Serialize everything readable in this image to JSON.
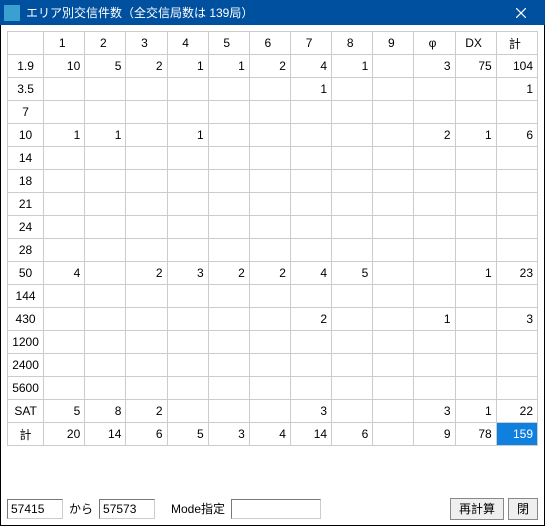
{
  "window": {
    "title": "エリア別交信件数（全交信局数は 139局）"
  },
  "grid": {
    "col_headers": [
      "1",
      "2",
      "3",
      "4",
      "5",
      "6",
      "7",
      "8",
      "9",
      "φ",
      "DX",
      "計"
    ],
    "row_headers": [
      "1.9",
      "3.5",
      "7",
      "10",
      "14",
      "18",
      "21",
      "24",
      "28",
      "50",
      "144",
      "430",
      "1200",
      "2400",
      "5600",
      "SAT",
      "計"
    ],
    "rows": [
      [
        "10",
        "5",
        "2",
        "1",
        "1",
        "2",
        "4",
        "1",
        "",
        "3",
        "75",
        "104"
      ],
      [
        "",
        "",
        "",
        "",
        "",
        "",
        "1",
        "",
        "",
        "",
        "",
        "1"
      ],
      [
        "",
        "",
        "",
        "",
        "",
        "",
        "",
        "",
        "",
        "",
        "",
        ""
      ],
      [
        "1",
        "1",
        "",
        "1",
        "",
        "",
        "",
        "",
        "",
        "2",
        "1",
        "6"
      ],
      [
        "",
        "",
        "",
        "",
        "",
        "",
        "",
        "",
        "",
        "",
        "",
        ""
      ],
      [
        "",
        "",
        "",
        "",
        "",
        "",
        "",
        "",
        "",
        "",
        "",
        ""
      ],
      [
        "",
        "",
        "",
        "",
        "",
        "",
        "",
        "",
        "",
        "",
        "",
        ""
      ],
      [
        "",
        "",
        "",
        "",
        "",
        "",
        "",
        "",
        "",
        "",
        "",
        ""
      ],
      [
        "",
        "",
        "",
        "",
        "",
        "",
        "",
        "",
        "",
        "",
        "",
        ""
      ],
      [
        "4",
        "",
        "2",
        "3",
        "2",
        "2",
        "4",
        "5",
        "",
        "",
        "1",
        "23"
      ],
      [
        "",
        "",
        "",
        "",
        "",
        "",
        "",
        "",
        "",
        "",
        "",
        ""
      ],
      [
        "",
        "",
        "",
        "",
        "",
        "",
        "2",
        "",
        "",
        "1",
        "",
        "3"
      ],
      [
        "",
        "",
        "",
        "",
        "",
        "",
        "",
        "",
        "",
        "",
        "",
        ""
      ],
      [
        "",
        "",
        "",
        "",
        "",
        "",
        "",
        "",
        "",
        "",
        "",
        ""
      ],
      [
        "",
        "",
        "",
        "",
        "",
        "",
        "",
        "",
        "",
        "",
        "",
        ""
      ],
      [
        "5",
        "8",
        "2",
        "",
        "",
        "",
        "3",
        "",
        "",
        "3",
        "1",
        "22"
      ],
      [
        "20",
        "14",
        "6",
        "5",
        "3",
        "4",
        "14",
        "6",
        "",
        "9",
        "78",
        "159"
      ]
    ],
    "highlight": {
      "row": 16,
      "col": 11
    }
  },
  "bottom": {
    "from_value": "57415",
    "from_to_label": "から",
    "to_value": "57573",
    "mode_label": "Mode指定",
    "mode_value": "",
    "recalc_label": "再計算",
    "close_label": "閉"
  }
}
